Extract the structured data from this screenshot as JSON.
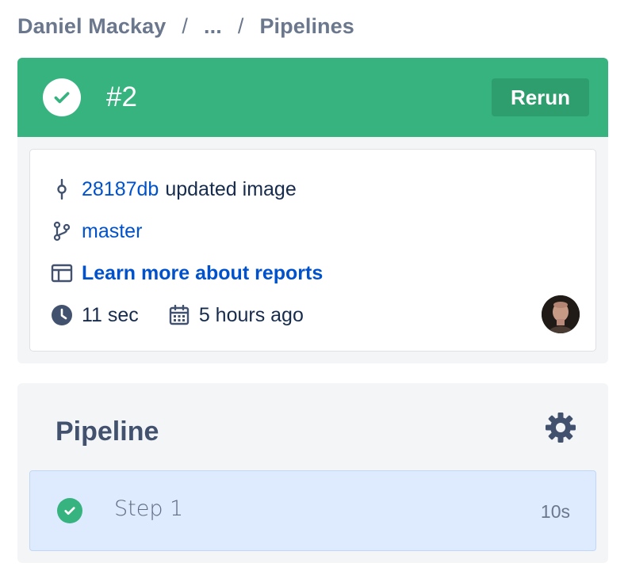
{
  "breadcrumb": {
    "owner": "Daniel Mackay",
    "ellipsis": "...",
    "current": "Pipelines",
    "separator": "/"
  },
  "build": {
    "status": "successful",
    "status_icon": "check-circle-icon",
    "number": "#2",
    "rerun_label": "Rerun",
    "header_color": "#36b37e"
  },
  "commit": {
    "hash": "28187db",
    "message": "updated image",
    "icon": "commit-icon"
  },
  "branch": {
    "name": "master",
    "icon": "branch-icon"
  },
  "reports": {
    "label": "Learn more about reports",
    "icon": "reports-icon"
  },
  "meta": {
    "duration": "11 sec",
    "duration_icon": "clock-icon",
    "created": "5 hours ago",
    "created_icon": "calendar-icon",
    "avatar_icon": "user-avatar"
  },
  "pipeline": {
    "title": "Pipeline",
    "settings_icon": "gear-icon",
    "steps": [
      {
        "name": "Step 1",
        "duration": "10s",
        "status": "successful"
      }
    ]
  },
  "colors": {
    "success": "#36b37e",
    "link": "#0052cc",
    "step_bg": "#deebff"
  }
}
